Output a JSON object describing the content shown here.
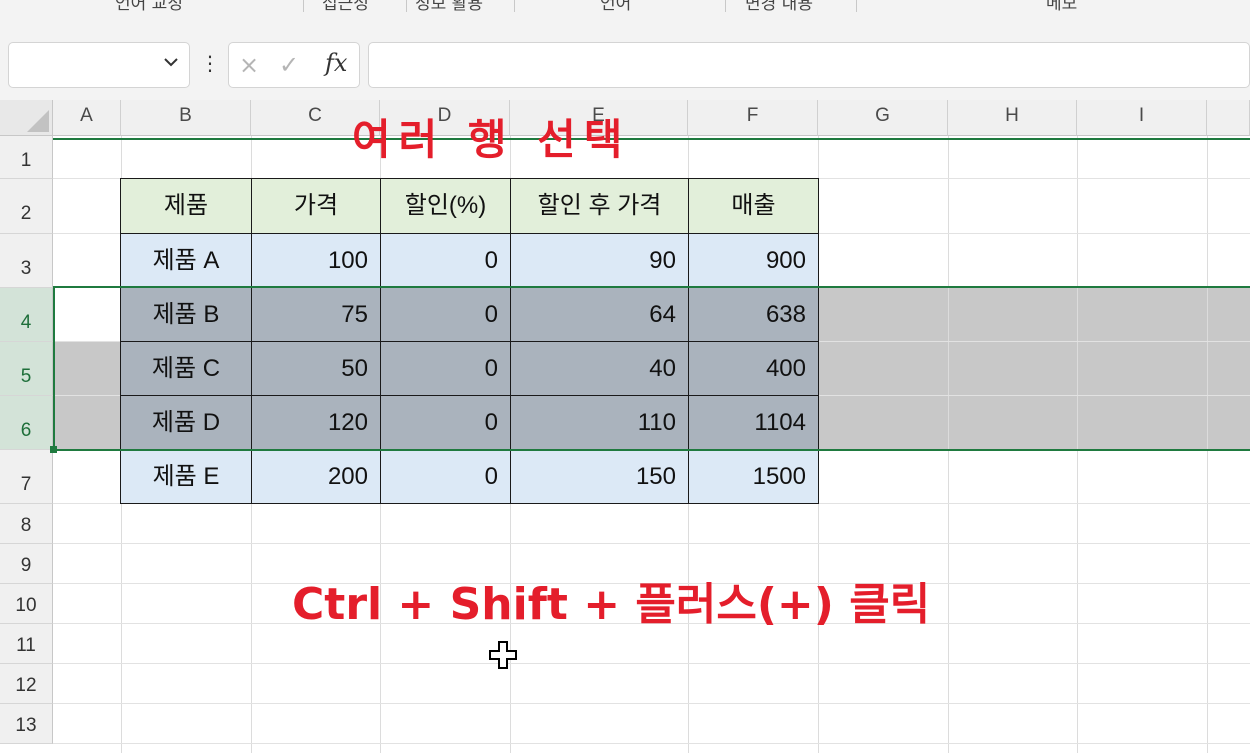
{
  "ribbon": {
    "groups": [
      "언어 교정",
      "접근성",
      "정보 활용",
      "언어",
      "변경 내용",
      "메모"
    ]
  },
  "formula_bar": {
    "name_box_value": "",
    "more_label": "⋮",
    "cancel_icon": "×",
    "enter_icon": "✓",
    "fx_label": "fx",
    "formula_value": ""
  },
  "grid": {
    "columns": [
      "A",
      "B",
      "C",
      "D",
      "E",
      "F",
      "G",
      "H",
      "I"
    ],
    "rows": [
      "1",
      "2",
      "3",
      "4",
      "5",
      "6",
      "7",
      "8",
      "9",
      "10",
      "11",
      "12",
      "13"
    ],
    "selected_rows": [
      "4",
      "5",
      "6"
    ]
  },
  "table": {
    "headers": [
      "제품",
      "가격",
      "할인(%)",
      "할인 후 가격",
      "매출"
    ],
    "rows": [
      [
        "제품 A",
        "100",
        "0",
        "90",
        "900"
      ],
      [
        "제품 B",
        "75",
        "0",
        "64",
        "638"
      ],
      [
        "제품 C",
        "50",
        "0",
        "40",
        "400"
      ],
      [
        "제품 D",
        "120",
        "0",
        "110",
        "1104"
      ],
      [
        "제품 E",
        "200",
        "0",
        "150",
        "1500"
      ]
    ]
  },
  "annotations": {
    "title": "여러 행 선택",
    "shortcut": "Ctrl + Shift + 플러스(+) 클릭"
  },
  "colors": {
    "annotation_red": "#e41e2b",
    "selection_green": "#1f7a3f",
    "header_fill": "#e2efda",
    "body_fill": "#dce9f6",
    "selected_fill": "#aab3bd"
  }
}
